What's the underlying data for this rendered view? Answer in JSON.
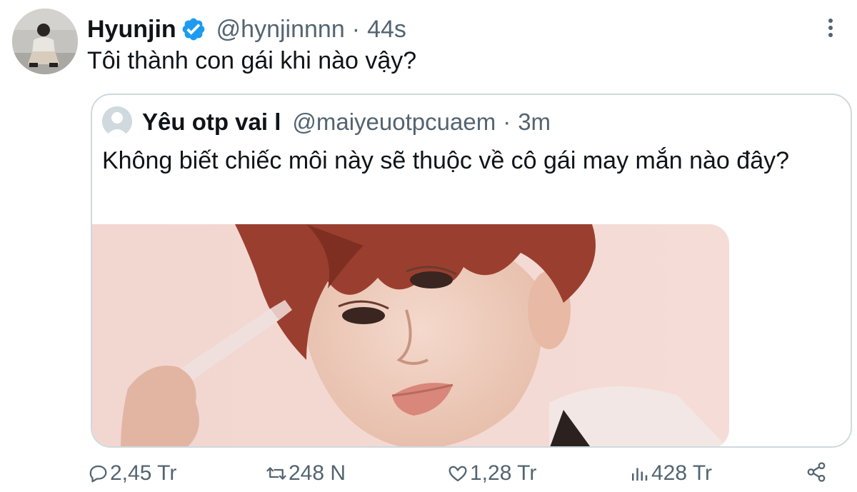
{
  "author": {
    "name": "Hyunjin",
    "handle": "@hynjinnnn",
    "separator": "·",
    "time": "44s"
  },
  "tweet": {
    "text": "Tôi thành con gái khi nào vậy?"
  },
  "quoted": {
    "name": "Yêu otp vai l",
    "handle": "@maiyeuotpcuaem",
    "separator": "·",
    "time": "3m",
    "text": "Không biết chiếc môi này sẽ thuộc về cô gái may mắn nào đây?"
  },
  "actions": {
    "replies": "2,45 Tr",
    "retweets": "248 N",
    "likes": "1,28 Tr",
    "views": "428 Tr"
  },
  "colors": {
    "text": "#0f1419",
    "secondary": "#536471",
    "border": "#cfd9de",
    "verified": "#1d9bf0"
  },
  "icons": [
    "more-icon",
    "verified-badge-icon",
    "reply-icon",
    "retweet-icon",
    "like-icon",
    "views-icon",
    "share-icon"
  ]
}
